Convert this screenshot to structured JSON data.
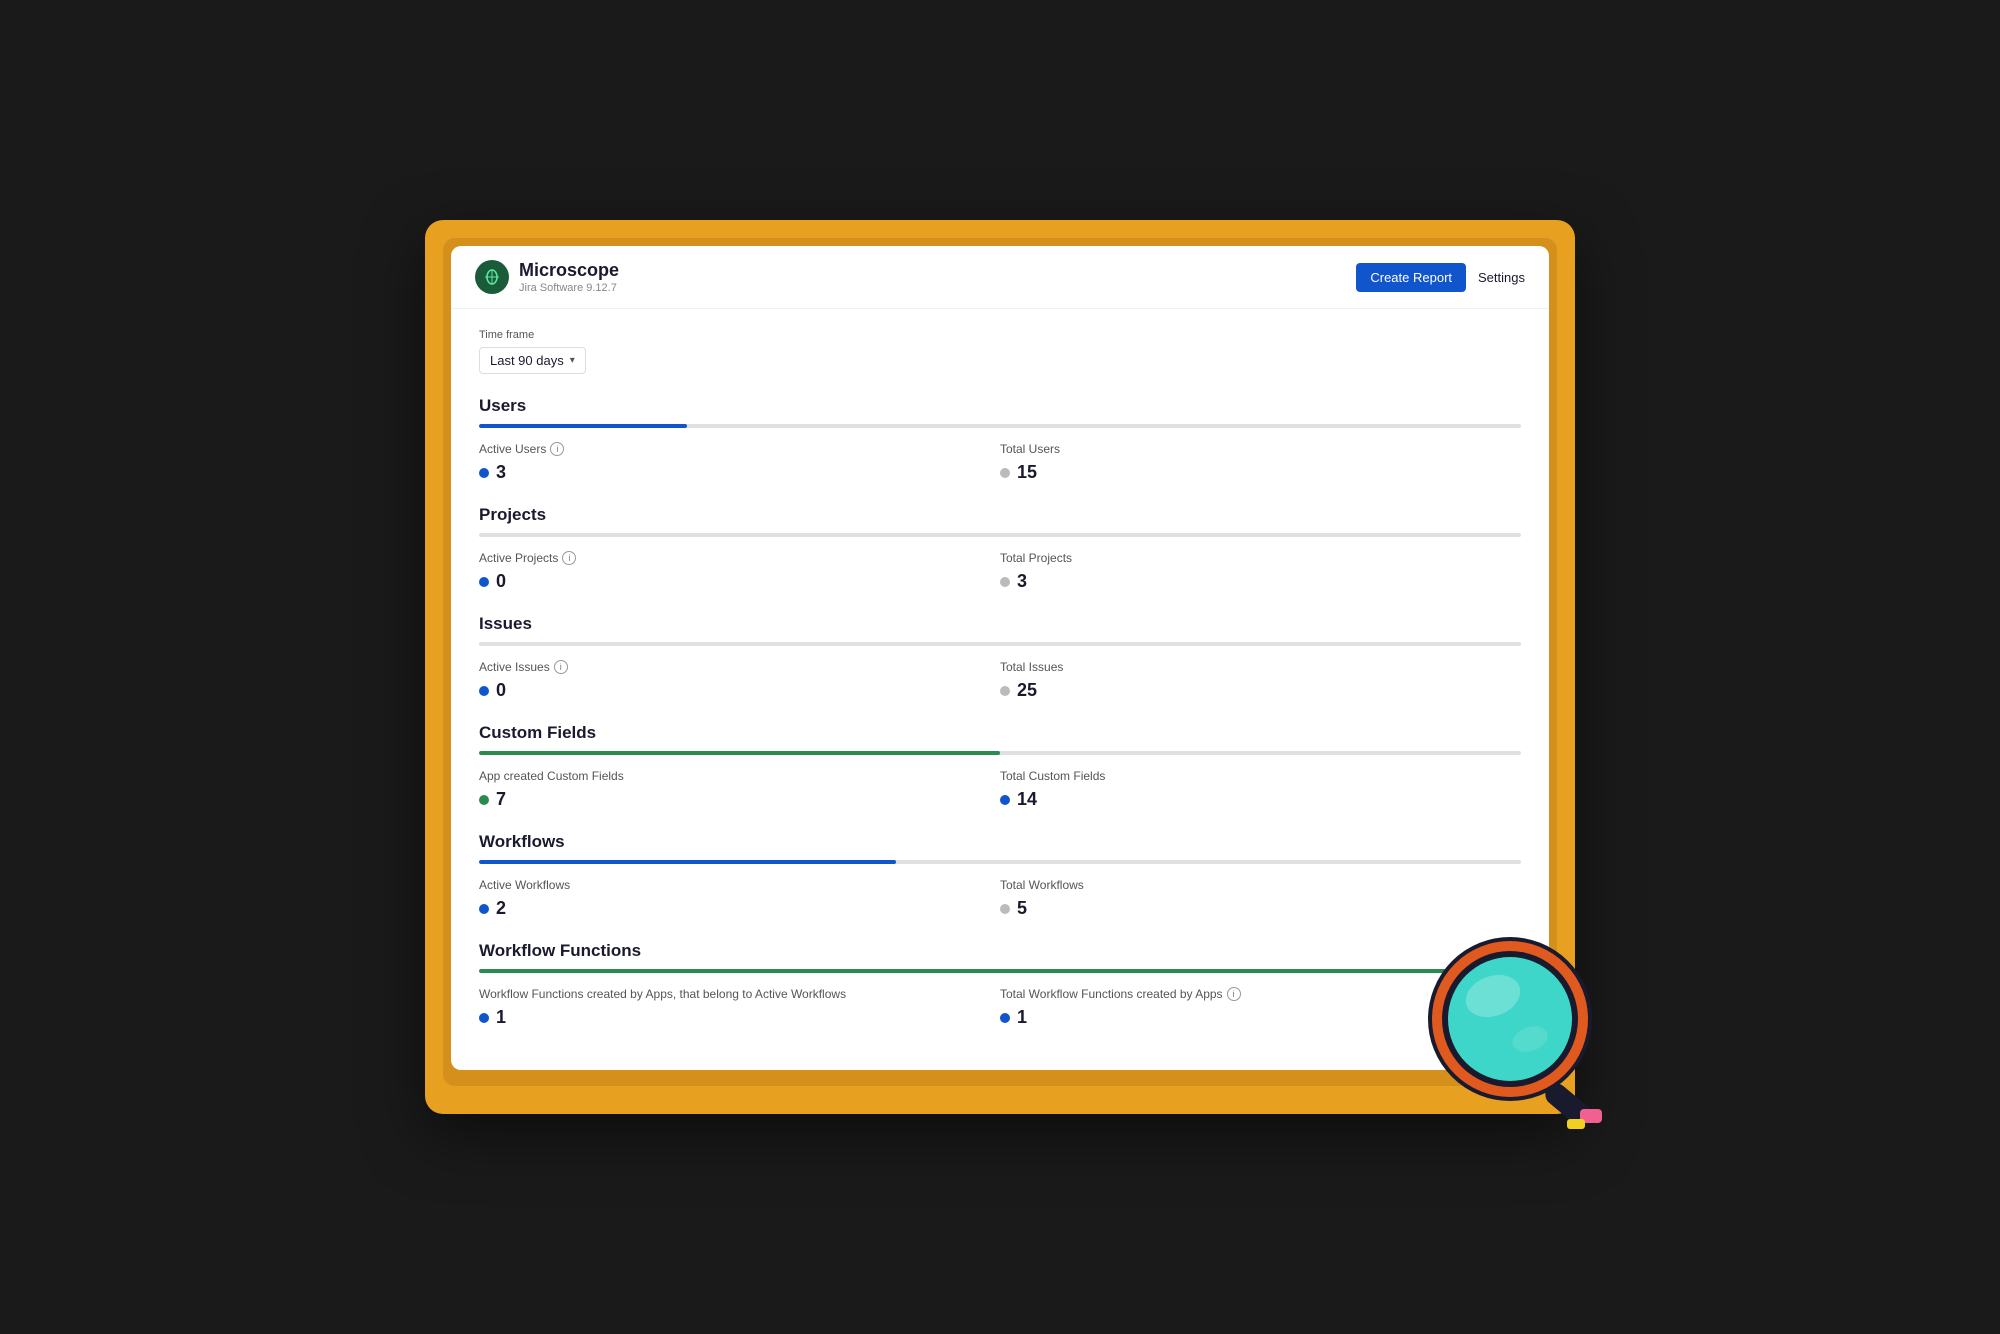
{
  "brand": {
    "logo_char": "🔬",
    "name": "Microscope",
    "subtitle": "Jira Software 9.12.7"
  },
  "header": {
    "create_report_label": "Create Report",
    "settings_label": "Settings"
  },
  "timeframe": {
    "label": "Time frame",
    "value": "Last 90 days"
  },
  "sections": [
    {
      "id": "users",
      "title": "Users",
      "bar_pct": 20,
      "bar_color": "#1055cc",
      "metrics": [
        {
          "label": "Active Users",
          "has_info": true,
          "value": "3",
          "dot": "blue"
        },
        {
          "label": "Total Users",
          "has_info": false,
          "value": "15",
          "dot": "gray"
        }
      ]
    },
    {
      "id": "projects",
      "title": "Projects",
      "bar_pct": 0,
      "bar_color": "#1055cc",
      "metrics": [
        {
          "label": "Active Projects",
          "has_info": true,
          "value": "0",
          "dot": "blue"
        },
        {
          "label": "Total Projects",
          "has_info": false,
          "value": "3",
          "dot": "gray"
        }
      ]
    },
    {
      "id": "issues",
      "title": "Issues",
      "bar_pct": 0,
      "bar_color": "#1055cc",
      "metrics": [
        {
          "label": "Active Issues",
          "has_info": true,
          "value": "0",
          "dot": "blue"
        },
        {
          "label": "Total Issues",
          "has_info": false,
          "value": "25",
          "dot": "gray"
        }
      ]
    },
    {
      "id": "custom-fields",
      "title": "Custom Fields",
      "bar_pct": 50,
      "bar_color": "#2a8a50",
      "metrics": [
        {
          "label": "App created Custom Fields",
          "has_info": false,
          "value": "7",
          "dot": "green"
        },
        {
          "label": "Total Custom Fields",
          "has_info": false,
          "value": "14",
          "dot": "blue"
        }
      ]
    },
    {
      "id": "workflows",
      "title": "Workflows",
      "bar_pct": 40,
      "bar_color": "#1055cc",
      "metrics": [
        {
          "label": "Active Workflows",
          "has_info": false,
          "value": "2",
          "dot": "blue"
        },
        {
          "label": "Total Workflows",
          "has_info": false,
          "value": "5",
          "dot": "gray"
        }
      ]
    },
    {
      "id": "workflow-functions",
      "title": "Workflow Functions",
      "bar_pct": 100,
      "bar_color": "#2a8a50",
      "metrics": [
        {
          "label": "Workflow Functions created by Apps, that belong to Active Workflows",
          "has_info": false,
          "value": "1",
          "dot": "blue"
        },
        {
          "label": "Total Workflow Functions created by Apps",
          "has_info": true,
          "value": "1",
          "dot": "blue"
        }
      ]
    }
  ]
}
